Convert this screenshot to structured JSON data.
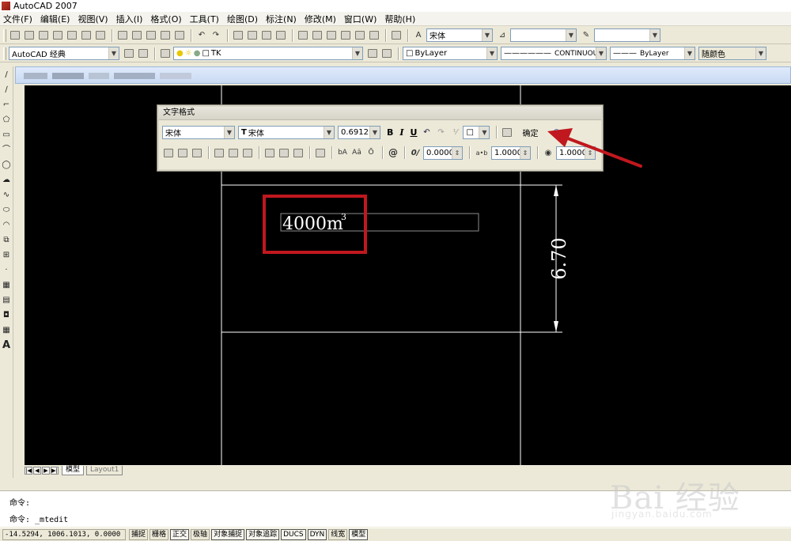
{
  "app": {
    "title": "AutoCAD 2007"
  },
  "menu": {
    "items": [
      "文件(F)",
      "编辑(E)",
      "视图(V)",
      "插入(I)",
      "格式(O)",
      "工具(T)",
      "绘图(D)",
      "标注(N)",
      "修改(M)",
      "窗口(W)",
      "帮助(H)"
    ]
  },
  "toolbar1": {
    "font_value": "宋体",
    "style_combo_value": "",
    "linetype_combo_value": ""
  },
  "toolbar2": {
    "workspace_value": "AutoCAD 经典",
    "layer_value": "TK",
    "color_value": "ByLayer",
    "linetype_value": "CONTINUOUS",
    "lineweight_value": "ByLayer",
    "plotstyle_value": "随颜色"
  },
  "text_format": {
    "title": "文字格式",
    "style_value": "宋体",
    "font_value": "宋体",
    "height_value": "0.6912",
    "bold_label": "B",
    "italic_label": "I",
    "underline_label": "U",
    "ok_label": "确定",
    "oblique_value": "0.0000",
    "tracking_value": "1.0000",
    "width_value": "1.0000"
  },
  "drawing": {
    "text_main": "4000m",
    "text_superscript": "3",
    "dimension_value": "6.70"
  },
  "tabs": {
    "model": "模型",
    "layout1": "Layout1"
  },
  "command": {
    "line1": "命令:",
    "line2": "命令: _mtedit"
  },
  "status": {
    "coords": "-14.5294, 1006.1013, 0.0000",
    "buttons": [
      "捕捉",
      "栅格",
      "正交",
      "极轴",
      "对象捕捉",
      "对象追踪",
      "DUCS",
      "DYN",
      "线宽",
      "模型"
    ]
  },
  "watermark": {
    "brand": "Bai 经验",
    "url": "jingyan.baidu.com"
  },
  "colors": {
    "canvas": "#000000",
    "highlight_box": "#c0181e",
    "arrow": "#c0181e",
    "line_color": "#ffffff"
  }
}
